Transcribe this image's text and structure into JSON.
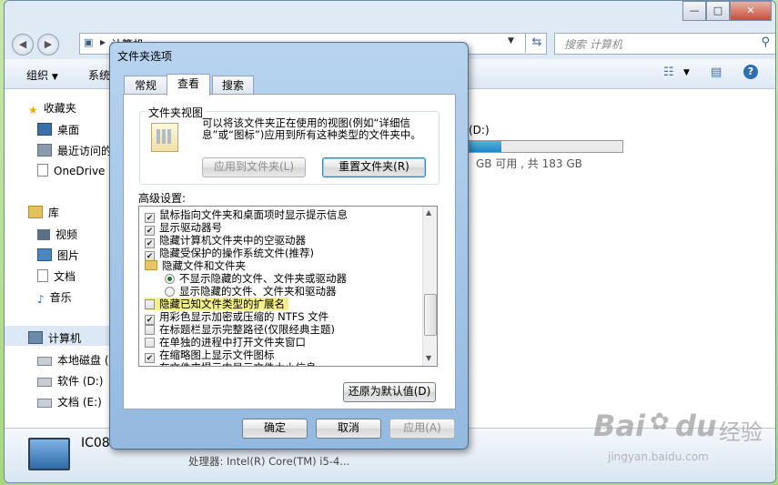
{
  "explorer": {
    "breadcrumb": "计算机",
    "search_placeholder": "搜索 计算机",
    "toolbar": {
      "organize": "组织",
      "system": "系统"
    },
    "caption": {
      "minimize": "—",
      "maximize": "□",
      "close": "✕"
    },
    "sidebar": {
      "favorites": "收藏夹",
      "favorites_items": [
        "桌面",
        "最近访问的",
        "OneDrive"
      ],
      "libraries": "库",
      "library_items": [
        "视频",
        "图片",
        "文档",
        "音乐"
      ],
      "computer": "计算机",
      "computer_items": [
        "本地磁盘 (",
        "软件 (D:)",
        "文档 (E:)"
      ]
    },
    "drive": {
      "label": "(D:)",
      "free_text": "GB 可用 , 共 183 GB",
      "fill_percent": 21
    },
    "details": {
      "name": "IC08",
      "processor": "处理器: Intel(R) Core(TM) i5-4..."
    }
  },
  "dialog": {
    "title": "文件夹选项",
    "tabs": [
      "常规",
      "查看",
      "搜索"
    ],
    "selected_tab": "查看",
    "folder_views": {
      "group_label": "文件夹视图",
      "description": "可以将该文件夹正在使用的视图(例如“详细信息”或“图标”)应用到所有这种类型的文件夹中。",
      "apply_button": "应用到文件夹(L)",
      "reset_button": "重置文件夹(R)"
    },
    "advanced_label": "高级设置:",
    "settings": [
      {
        "type": "checkbox",
        "checked": true,
        "label": "鼠标指向文件夹和桌面项时显示提示信息"
      },
      {
        "type": "checkbox",
        "checked": true,
        "label": "显示驱动器号"
      },
      {
        "type": "checkbox",
        "checked": true,
        "label": "隐藏计算机文件夹中的空驱动器"
      },
      {
        "type": "checkbox",
        "checked": true,
        "label": "隐藏受保护的操作系统文件(推荐)"
      },
      {
        "type": "folder",
        "label": "隐藏文件和文件夹"
      },
      {
        "type": "radio",
        "checked": true,
        "label": "不显示隐藏的文件、文件夹或驱动器"
      },
      {
        "type": "radio",
        "checked": false,
        "label": "显示隐藏的文件、文件夹和驱动器"
      },
      {
        "type": "checkbox",
        "checked": false,
        "label": "隐藏已知文件类型的扩展名",
        "highlight": true
      },
      {
        "type": "checkbox",
        "checked": true,
        "label": "用彩色显示加密或压缩的 NTFS 文件"
      },
      {
        "type": "checkbox",
        "checked": false,
        "label": "在标题栏显示完整路径(仅限经典主题)"
      },
      {
        "type": "checkbox",
        "checked": false,
        "label": "在单独的进程中打开文件夹窗口"
      },
      {
        "type": "checkbox",
        "checked": true,
        "label": "在缩略图上显示文件图标"
      },
      {
        "type": "checkbox",
        "checked": true,
        "label": "在文件夹提示中显示文件大小信息"
      }
    ],
    "restore_button": "还原为默认值(D)",
    "ok_button": "确定",
    "cancel_button": "取消",
    "apply_button": "应用(A)",
    "highlight_color": "#f5f08a"
  },
  "watermark": {
    "brand": "Bai",
    "brand2": "du",
    "brand_cn": "经验",
    "url": "jingyan.baidu.com"
  }
}
